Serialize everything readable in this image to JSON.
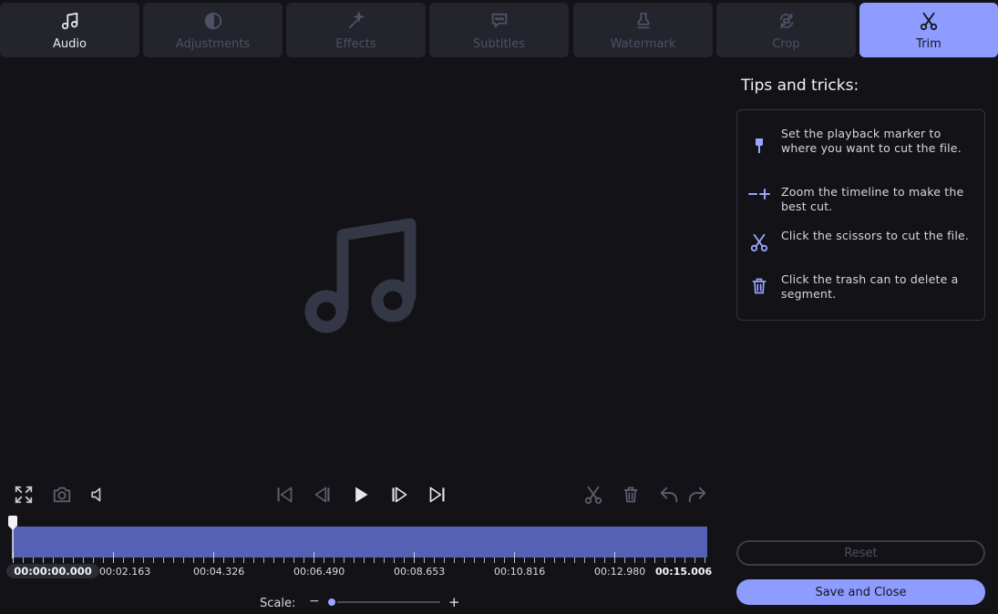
{
  "tabs": [
    {
      "label": "Audio",
      "icon": "music-note-icon",
      "state": "enabled"
    },
    {
      "label": "Adjustments",
      "icon": "contrast-icon",
      "state": "disabled"
    },
    {
      "label": "Effects",
      "icon": "magic-wand-icon",
      "state": "disabled"
    },
    {
      "label": "Subtitles",
      "icon": "speech-bubble-icon",
      "state": "disabled"
    },
    {
      "label": "Watermark",
      "icon": "stamp-icon",
      "state": "disabled"
    },
    {
      "label": "Crop",
      "icon": "rotate-icon",
      "state": "disabled"
    },
    {
      "label": "Trim",
      "icon": "scissors-icon",
      "state": "active"
    }
  ],
  "preview": {
    "icon": "music-note-icon"
  },
  "tips": {
    "title": "Tips and tricks:",
    "items": [
      {
        "icon": "playback-marker-icon",
        "text": "Set the playback marker to where you want to cut the file."
      },
      {
        "icon": "zoom-timeline-icon",
        "text": "Zoom the timeline to make the best cut."
      },
      {
        "icon": "scissors-icon",
        "text": "Click the scissors to cut the file."
      },
      {
        "icon": "trash-icon",
        "text": "Click the trash can to delete a segment."
      }
    ]
  },
  "controls": {
    "left": [
      "fullscreen-icon",
      "snapshot-icon",
      "volume-icon"
    ],
    "playback": [
      "skip-to-start-icon",
      "previous-frame-icon",
      "play-icon",
      "next-frame-icon",
      "skip-to-end-icon"
    ],
    "edit": [
      "scissors-icon",
      "trash-icon",
      "undo-icon",
      "redo-icon"
    ]
  },
  "timeline": {
    "current_time": "00:00:00.000",
    "labels": [
      "00:02.163",
      "00:04.326",
      "00:06.490",
      "00:08.653",
      "00:10.816",
      "00:12.980"
    ],
    "end_time": "00:15.006",
    "playhead_position_fraction": 0.0
  },
  "scale": {
    "label": "Scale:",
    "minus": "−",
    "plus": "+",
    "value_fraction": 0.0
  },
  "buttons": {
    "reset": "Reset",
    "save": "Save and Close"
  },
  "colors": {
    "accent": "#8f9cff",
    "track": "#5461b4",
    "background": "#131317",
    "tab_bg": "#23242c"
  }
}
